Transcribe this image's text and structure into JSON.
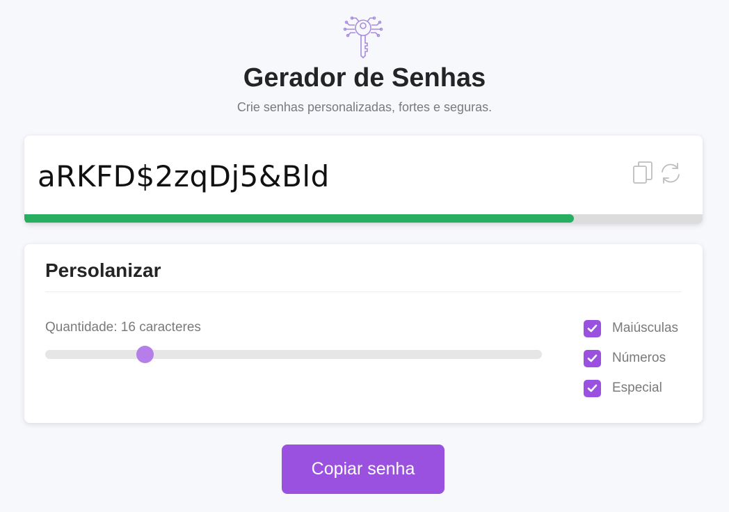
{
  "header": {
    "logo_icon": "key-circuit-icon",
    "title": "Gerador de Senhas",
    "subtitle": "Crie senhas personalizadas, fortes e seguras."
  },
  "password": {
    "value": "aRKFD$2zqDj5&Bld",
    "copy_icon": "copy-icon",
    "refresh_icon": "refresh-icon",
    "strength_fraction": 0.81,
    "strength_color": "#27ae60"
  },
  "customize": {
    "title": "Persolanizar",
    "length_label": "Quantidade: 16 caracteres",
    "length_value": 16,
    "length_min": 4,
    "length_max": 64,
    "options": [
      {
        "label": "Maiúsculas",
        "checked": true
      },
      {
        "label": "Números",
        "checked": true
      },
      {
        "label": "Especial",
        "checked": true
      }
    ]
  },
  "copy_button": {
    "label": "Copiar senha"
  },
  "colors": {
    "accent": "#9b51e0",
    "slider_thumb": "#b57ee8",
    "background": "#f7f8fc"
  }
}
